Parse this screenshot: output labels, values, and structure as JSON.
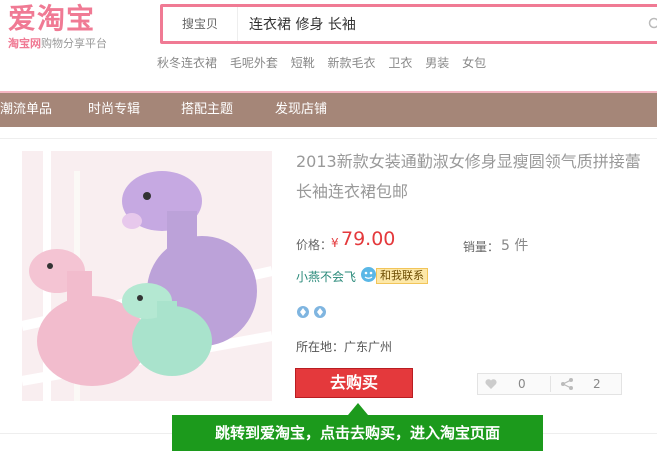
{
  "logo": {
    "main": "爱淘宝",
    "sub_brand": "淘宝网",
    "sub_slogan": "购物分享平台"
  },
  "search": {
    "type_label": "搜宝贝",
    "value": "连衣裙 修身 长袖"
  },
  "hot_keywords": [
    "秋冬连衣裙",
    "毛呢外套",
    "短靴",
    "新款毛衣",
    "卫衣",
    "男装",
    "女包"
  ],
  "nav": [
    "潮流单品",
    "时尚专辑",
    "搭配主题",
    "发现店铺"
  ],
  "product": {
    "title_line1": "2013新款女装通勤淑女修身显瘦圆领气质拼接蕾",
    "title_line2": "长袖连衣裙包邮",
    "price_label": "价格：",
    "currency": "¥",
    "price": "79.00",
    "sales_label": "销量：",
    "sales_value": "5 件",
    "seller": "小燕不会飞",
    "contact_label": "和我联系",
    "location": "所在地：广东广州",
    "buy_label": "去购买",
    "like_count": "0",
    "share_count": "2"
  },
  "tip": "跳转到爱淘宝，点击去购买，进入淘宝页面",
  "colors": {
    "accent_pink": "#f07a94",
    "nav_brown": "#a58678",
    "price_red": "#e4393c",
    "tip_green": "#1c9a1c"
  }
}
